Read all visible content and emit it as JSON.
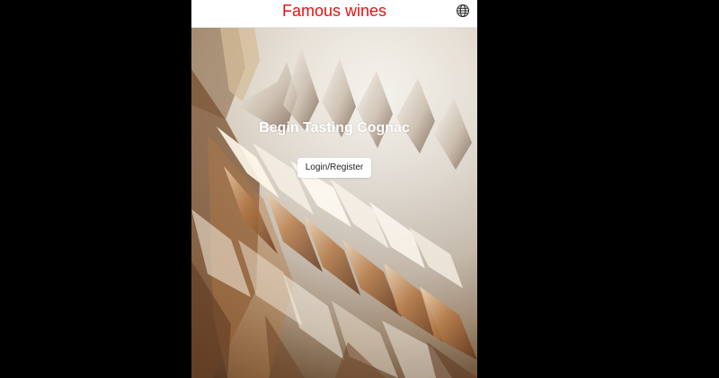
{
  "header": {
    "title": "Famous wines",
    "language_icon": "globe-icon"
  },
  "hero": {
    "title": "Begin Tasting Cognac",
    "cta_label": "Login/Register"
  },
  "colors": {
    "brand": "#e8100f",
    "page_background": "#000000",
    "header_background": "#ffffff",
    "button_background": "#ffffff"
  }
}
